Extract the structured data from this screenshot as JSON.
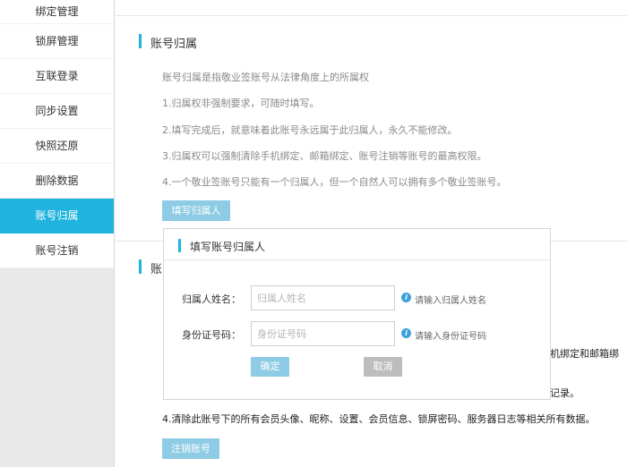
{
  "sidebar": {
    "items": [
      {
        "label": "绑定管理"
      },
      {
        "label": "锁屏管理"
      },
      {
        "label": "互联登录"
      },
      {
        "label": "同步设置"
      },
      {
        "label": "快照还原"
      },
      {
        "label": "删除数据"
      },
      {
        "label": "账号归属",
        "active": true
      },
      {
        "label": "账号注销"
      }
    ]
  },
  "ownership": {
    "title": "账号归属",
    "intro": "账号归属是指敬业签账号从法律角度上的所属权",
    "points": [
      "1.归属权非强制要求，可随时填写。",
      "2.填写完成后，就意味着此账号永远属于此归属人，永久不能修改。",
      "3.归属权可以强制清除手机绑定、邮箱绑定、账号注销等账号的最高权限。",
      "4.一个敬业签账号只能有一个归属人，但一个自然人可以拥有多个敬业签账号。"
    ],
    "fill_button": "填写归属人"
  },
  "cancel_section": {
    "title_partial": "账",
    "right_fragment_1": "机绑定和邮箱绑",
    "right_fragment_2": "记录。",
    "point4": "4.清除此账号下的所有会员头像、昵称、设置、会员信息、锁屏密码、服务器日志等相关所有数据。",
    "cancel_button": "注销账号"
  },
  "modal": {
    "title": "填写账号归属人",
    "name_label": "归属人姓名：",
    "name_placeholder": "归属人姓名",
    "name_hint": "请输入归属人姓名",
    "id_label": "身份证号码：",
    "id_placeholder": "身份证号码",
    "id_hint": "请输入身份证号码",
    "confirm": "确定",
    "cancel": "取消"
  },
  "colors": {
    "accent": "#1fb3dd",
    "button_blue": "#8ecbe4",
    "button_gray": "#bdbdbd",
    "info_icon": "#3ea0d8"
  }
}
